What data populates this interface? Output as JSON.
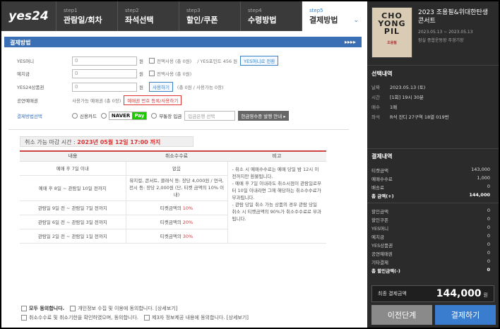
{
  "logo": "yes24",
  "steps": [
    {
      "num": "step1",
      "label": "관람일/회차"
    },
    {
      "num": "step2",
      "label": "좌석선택"
    },
    {
      "num": "step3",
      "label": "할인/쿠폰"
    },
    {
      "num": "step4",
      "label": "수령방법"
    },
    {
      "num": "step5",
      "label": "결제방법"
    }
  ],
  "section_title": "결제방법",
  "section_arrows": "▸▸▸▸",
  "payment_rows": {
    "yes_money": {
      "label": "YES머니",
      "value": "0",
      "unit": "원",
      "use_all": "전액사용 (총 0원)",
      "points": "/ YES포인트 456 원",
      "button": "YES머니로 전환"
    },
    "deposit": {
      "label": "예치금",
      "value": "0",
      "unit": "원",
      "use_all": "전액사용 (총 0원)"
    },
    "giftcard": {
      "label": "YES24상품권",
      "value": "0",
      "unit": "원",
      "button": "사용하기",
      "info": "(총 0원 / 사용가능 0장)"
    },
    "show_voucher": {
      "label": "공연예매권",
      "info": "사용가능 예매권 (총 0장)",
      "button": "예매권 번호 등록/사용하기"
    },
    "method": {
      "label": "결제방법선택",
      "card": "신용카드",
      "naver1": "NAVER",
      "naver2": "Pay",
      "bank": "무통장 입금",
      "select_placeholder": "입금은행 선택",
      "receipt_button": "현금영수증 발행 안내 ▸"
    }
  },
  "deadline": {
    "label": "취소 가능 마감 시간 :",
    "value": "2023년 05월 12일 17:00 까지"
  },
  "table": {
    "headers": [
      "내용",
      "취소수수료",
      "비고"
    ],
    "rows": [
      {
        "content": "예매 후 7일 이내",
        "fee": "없음",
        "fee_red": ""
      },
      {
        "content": "예매 후 8일 ~ 관람일 10일 전까지",
        "fee": "뮤지컬, 콘서트, 클래식 등: 장당 4,000원 / 연극, 전시 등: 장당 2,000원 (단, 티켓 금액의 10% 이내)",
        "fee_red": ""
      },
      {
        "content": "관람일 9일 전 ~ 관람일 7일 전까지",
        "fee": "티켓금액의 ",
        "fee_red": "10%"
      },
      {
        "content": "관람일 6일 전 ~ 관람일 3일 전까지",
        "fee": "티켓금액의 ",
        "fee_red": "20%"
      },
      {
        "content": "관람일 2일 전 ~ 관람일 1일 전까지",
        "fee": "티켓금액의 ",
        "fee_red": "30%"
      }
    ],
    "note": [
      "- 취소 시 예매수수료는 예매 당일 밤 12시 이전까지만 환불됩니다.",
      "- 예매 후 7일 이내라도 취소시점이 관람일로부터 10일 이내라면 그에 해당하는 취소수수료가 부과됩니다.",
      "- 관람 당일 취소 가능 상품의 경우 관람 당일 취소 시 티켓금액의 90%가 취소수수료로 부과됩니다."
    ]
  },
  "agreements": {
    "all": "모두 동의합니다.",
    "privacy": "개인정보 수집 및 이용에 동의합니다. [상세보기]",
    "fees": "취소수수료 및 취소기한을 확인하였으며, 동의합니다.",
    "third_party": "제3자 정보제공 내용에 동의합니다. [상세보기]"
  },
  "panel": {
    "poster_text": [
      "CHO",
      "YONG",
      "PIL"
    ],
    "poster_sub": "조용필",
    "title": "2023 조용필&위대한탄생 콘서트",
    "date": "2023.05.13 ~ 2023.05.13",
    "venue": "잠실 종합운동장 주경기장",
    "selection_title": "선택내역",
    "selection": [
      {
        "k": "날짜",
        "v": "2023.05.13 (토)"
      },
      {
        "k": "시간",
        "v": "[1회] 19시 30분"
      },
      {
        "k": "매수",
        "v": "1매"
      },
      {
        "k": "좌석",
        "v": "R석 잔디 27구역 18열 019번"
      }
    ],
    "payment_title": "결제내역",
    "payment": [
      {
        "k": "티켓금액",
        "v": "143,000"
      },
      {
        "k": "예매수수료",
        "v": "1,000"
      },
      {
        "k": "배송료",
        "v": "0"
      },
      {
        "k": "총 금액(+)",
        "v": "144,000"
      }
    ],
    "discounts": [
      {
        "k": "할인금액",
        "v": "0"
      },
      {
        "k": "할인쿠폰",
        "v": "0"
      },
      {
        "k": "YES머니",
        "v": "0"
      },
      {
        "k": "예치금",
        "v": "0"
      },
      {
        "k": "YES상품권",
        "v": "0"
      },
      {
        "k": "공연예매권",
        "v": "0"
      },
      {
        "k": "기타결제",
        "v": "0"
      },
      {
        "k": "총 할인금액(-)",
        "v": "0"
      }
    ],
    "final_label": "최종 결제금액",
    "final_value": "144,000",
    "final_unit": "원",
    "prev_button": "이전단계",
    "next_button": "결제하기"
  }
}
